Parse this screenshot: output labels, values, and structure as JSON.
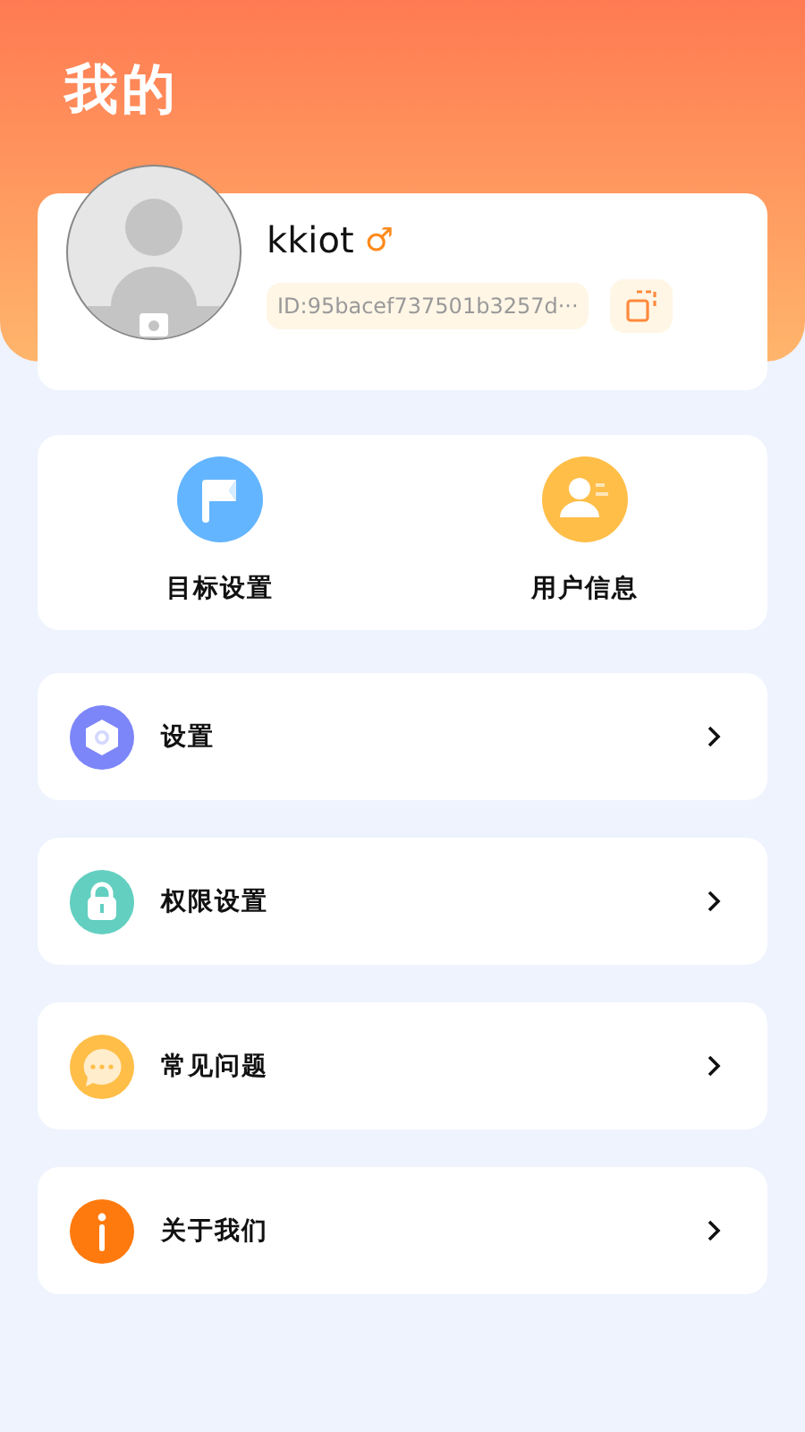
{
  "header": {
    "title": "我的"
  },
  "profile": {
    "name": "kkiot",
    "gender_symbol": "♂",
    "id_text": "ID:95bacef737501b3257d···"
  },
  "shortcuts": [
    {
      "kind": "flag",
      "label": "目标设置"
    },
    {
      "kind": "user",
      "label": "用户信息"
    }
  ],
  "menu": [
    {
      "kind": "gear",
      "label": "设置"
    },
    {
      "kind": "lock",
      "label": "权限设置"
    },
    {
      "kind": "chat",
      "label": "常见问题"
    },
    {
      "kind": "info",
      "label": "关于我们"
    }
  ]
}
